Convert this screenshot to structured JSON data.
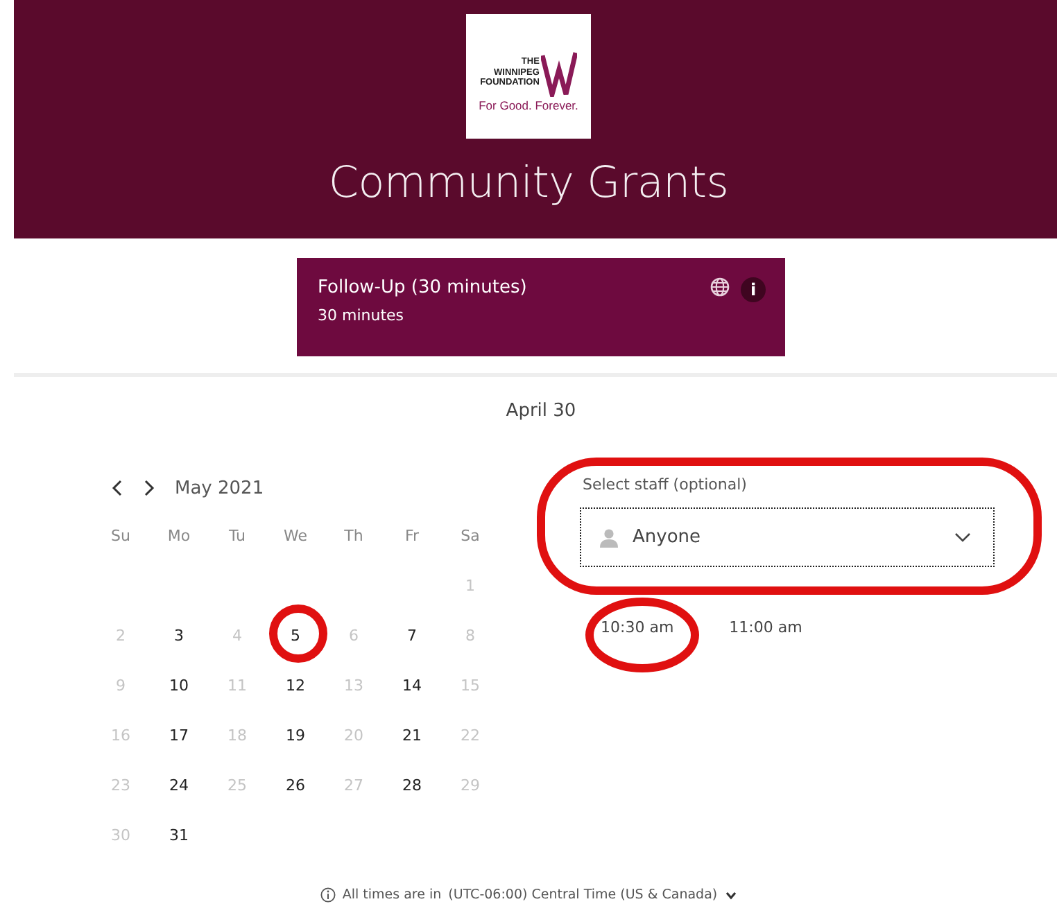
{
  "header": {
    "logo": {
      "line_1": "THE",
      "line_2": "WINNIPEG",
      "line_3": "FOUNDATION",
      "tagline": "For Good. Forever."
    },
    "title": "Community Grants"
  },
  "service": {
    "name": "Follow-Up (30 minutes)",
    "duration": "30 minutes",
    "info": "i"
  },
  "date_heading": "April 30",
  "calendar": {
    "month": "May 2021",
    "weekdays": [
      "Su",
      "Mo",
      "Tu",
      "We",
      "Th",
      "Fr",
      "Sa"
    ],
    "weeks": [
      [
        {
          "day": "1",
          "available": false
        }
      ],
      [
        {
          "day": "2",
          "available": false
        },
        {
          "day": "3",
          "available": true
        },
        {
          "day": "4",
          "available": false
        },
        {
          "day": "5",
          "available": true
        },
        {
          "day": "6",
          "available": false
        },
        {
          "day": "7",
          "available": true
        },
        {
          "day": "8",
          "available": false
        }
      ],
      [
        {
          "day": "9",
          "available": false
        },
        {
          "day": "10",
          "available": true
        },
        {
          "day": "11",
          "available": false
        },
        {
          "day": "12",
          "available": true
        },
        {
          "day": "13",
          "available": false
        },
        {
          "day": "14",
          "available": true
        },
        {
          "day": "15",
          "available": false
        }
      ],
      [
        {
          "day": "16",
          "available": false
        },
        {
          "day": "17",
          "available": true
        },
        {
          "day": "18",
          "available": false
        },
        {
          "day": "19",
          "available": true
        },
        {
          "day": "20",
          "available": false
        },
        {
          "day": "21",
          "available": true
        },
        {
          "day": "22",
          "available": false
        }
      ],
      [
        {
          "day": "23",
          "available": false
        },
        {
          "day": "24",
          "available": true
        },
        {
          "day": "25",
          "available": false
        },
        {
          "day": "26",
          "available": true
        },
        {
          "day": "27",
          "available": false
        },
        {
          "day": "28",
          "available": true
        },
        {
          "day": "29",
          "available": false
        }
      ],
      [
        {
          "day": "30",
          "available": false
        },
        {
          "day": "31",
          "available": true
        }
      ]
    ]
  },
  "staff": {
    "label": "Select staff (optional)",
    "value": "Anyone"
  },
  "times": [
    "10:30 am",
    "11:00 am"
  ],
  "timezone": {
    "prefix": "All times are in",
    "zone": "(UTC-06:00) Central Time (US & Canada)"
  }
}
